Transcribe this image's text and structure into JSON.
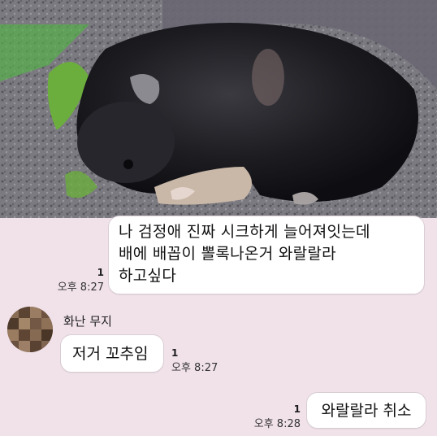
{
  "photo": {
    "description_icon": "sleeping-black-puppy-photo"
  },
  "messages": [
    {
      "text": "나 검정애 진짜 시크하게 늘어져잇는데\n배에 배꼽이 뽈록나온거 와랄랄라\n하고싶다",
      "unread": "1",
      "time": "오후 8:27"
    },
    {
      "sender": "화난 무지",
      "text": "저거 꼬추임",
      "unread": "1",
      "time": "오후 8:27"
    },
    {
      "text": "와랄랄라 취소",
      "unread": "1",
      "time": "오후 8:28"
    }
  ],
  "colors": {
    "background": "#f1e2ea",
    "bubble": "#ffffff"
  }
}
